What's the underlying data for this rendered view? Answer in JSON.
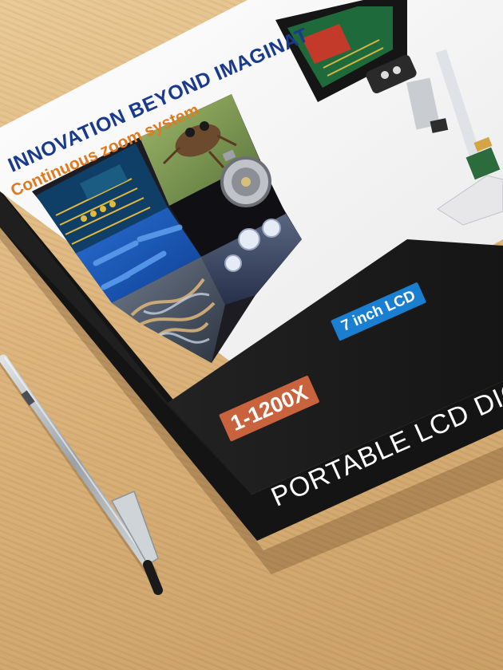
{
  "box": {
    "headline": "INNOVATION BEYOND IMAGINAT",
    "tagline": "Continuous zoom system",
    "magnification_badge": "1-1200X",
    "screen_badge": "7 inch LCD",
    "product_title": "PORTABLE LCD DIGITAL M"
  },
  "colors": {
    "desk": "#d9b07a",
    "box_top": "#f4f4f4",
    "box_side": "#1c1c1c",
    "headline": "#1a3a8c",
    "tagline": "#e07a1e",
    "zoom_badge": "#c9633d",
    "lcd_badge": "#1a7fd0"
  },
  "sample_images": [
    {
      "name": "circuit-board-image"
    },
    {
      "name": "jumping-spider-image"
    },
    {
      "name": "watch-movement-image"
    },
    {
      "name": "bacteria-image"
    },
    {
      "name": "diamonds-image"
    },
    {
      "name": "fibers-image"
    }
  ]
}
